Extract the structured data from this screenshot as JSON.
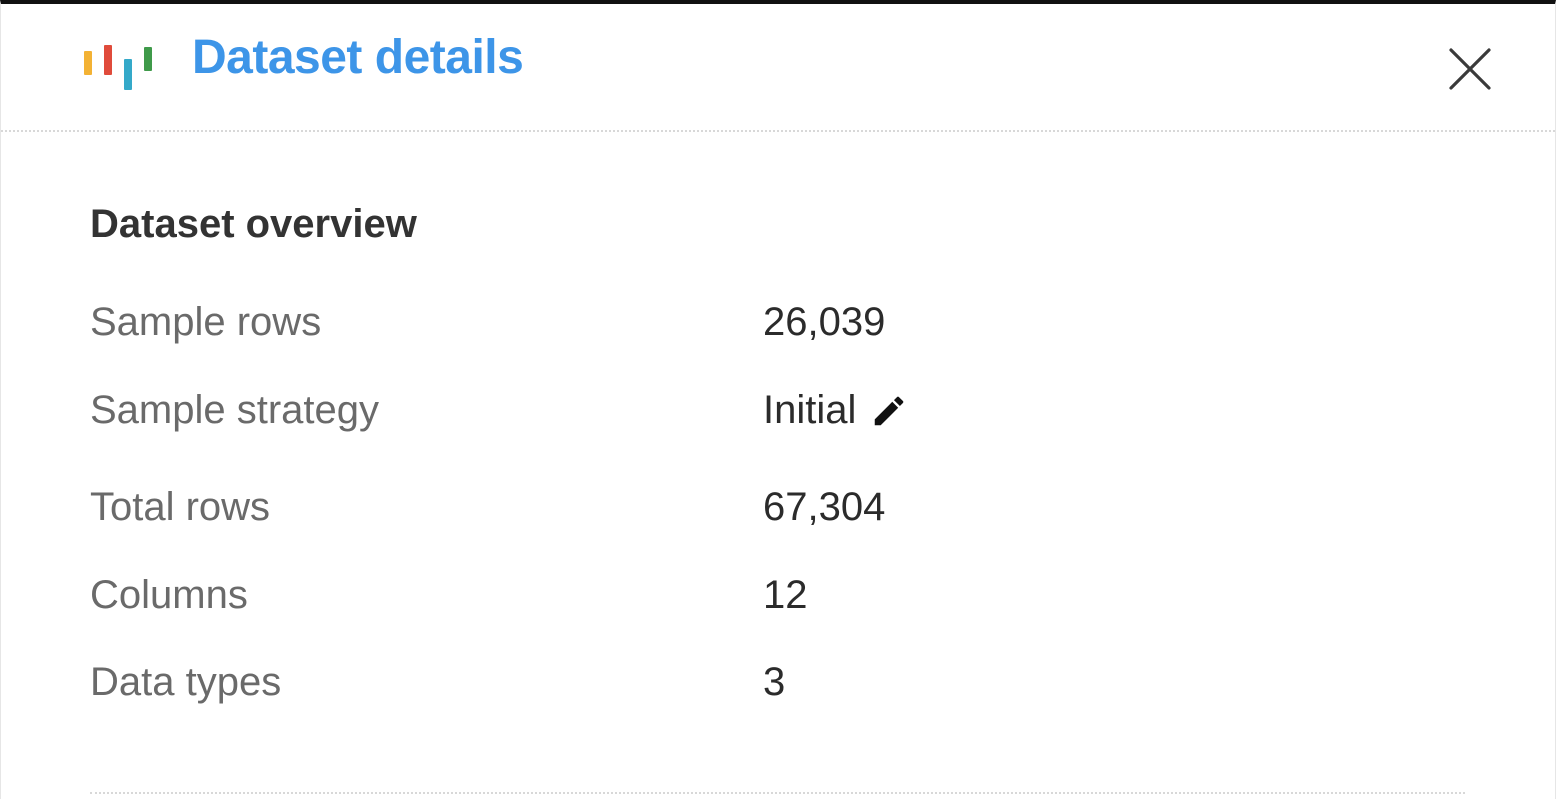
{
  "dialog": {
    "title": "Dataset details",
    "logo_icon": "bar-chart-logo-icon",
    "close_icon": "close-icon",
    "logo_colors": [
      "#f3b234",
      "#e04b3b",
      "#34a9c9",
      "#3f9a4a"
    ]
  },
  "overview": {
    "heading": "Dataset overview",
    "rows": [
      {
        "label": "Sample rows",
        "value": "26,039"
      },
      {
        "label": "Sample strategy",
        "value": "Initial",
        "edit_icon": "pencil-icon"
      },
      {
        "label": "Total rows",
        "value": "67,304"
      },
      {
        "label": "Columns",
        "value": "12"
      },
      {
        "label": "Data types",
        "value": "3"
      }
    ]
  }
}
